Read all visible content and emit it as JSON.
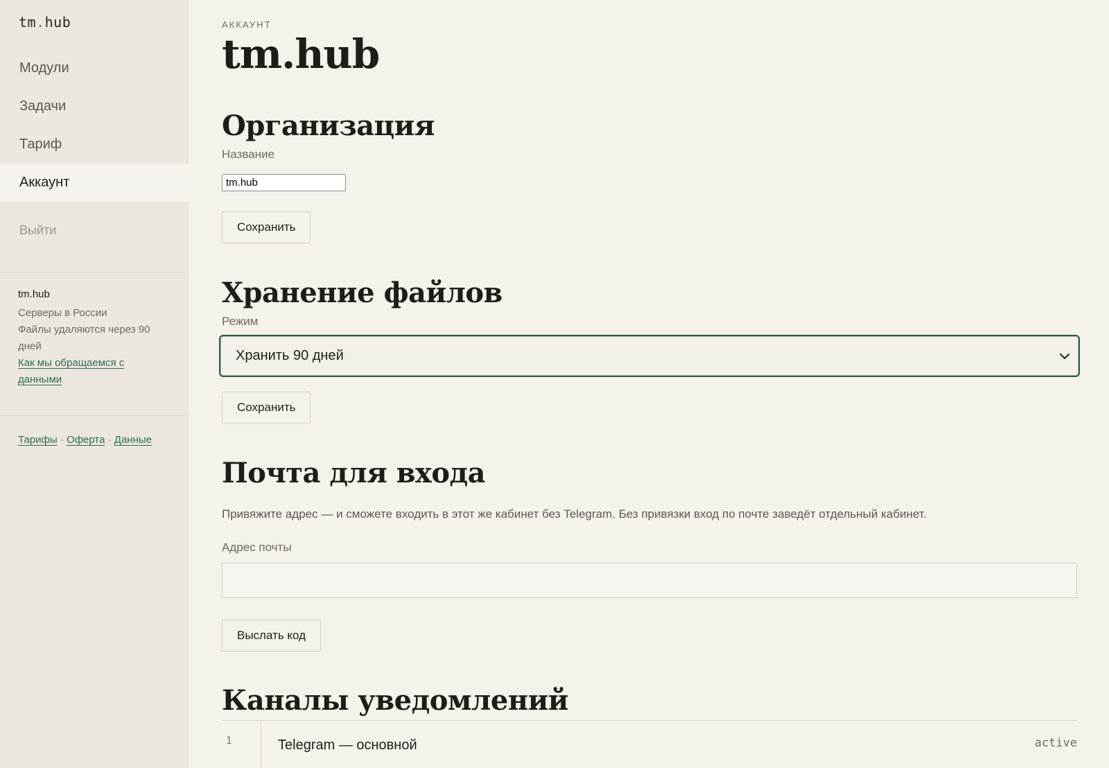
{
  "sidebar": {
    "logo_left": "tm",
    "logo_dot": ".",
    "logo_right": "hub",
    "nav": [
      {
        "label": "Модули"
      },
      {
        "label": "Задачи"
      },
      {
        "label": "Тариф"
      },
      {
        "label": "Аккаунт",
        "active": true
      }
    ],
    "logout": "Выйти",
    "info": {
      "org": "tm.hub",
      "servers": "Серверы в России",
      "retention_1": "Файлы удаляются через 90",
      "retention_2": "дней",
      "data_link_1": "Как мы обращаемся с",
      "data_link_2": "данными"
    },
    "footer": {
      "tariffs": "Тарифы",
      "sep": "·",
      "offer": "Оферта",
      "data": "Данные"
    }
  },
  "header": {
    "eyebrow": "АККАУНТ",
    "title": "tm.hub"
  },
  "organization": {
    "heading": "Организация",
    "name_label": "Название",
    "name_value": "tm.hub",
    "save": "Сохранить"
  },
  "storage": {
    "heading": "Хранение файлов",
    "mode_label": "Режим",
    "mode_value": "Хранить 90 дней",
    "save": "Сохранить"
  },
  "login_email": {
    "heading": "Почта для входа",
    "description": "Привяжите адрес — и сможете входить в этот же кабинет без Telegram. Без привязки вход по почте заведёт отдельный кабинет.",
    "email_label": "Адрес почты",
    "email_value": "",
    "send_code": "Выслать код"
  },
  "channels": {
    "heading": "Каналы уведомлений",
    "rows": [
      {
        "num": "1",
        "name": "Telegram — основной",
        "status": "active"
      }
    ]
  },
  "colors": {
    "background": "#f5f2ec",
    "sidebar": "#ebe6de",
    "accent": "#2e6b57",
    "focus_border": "#2f5b4d"
  }
}
